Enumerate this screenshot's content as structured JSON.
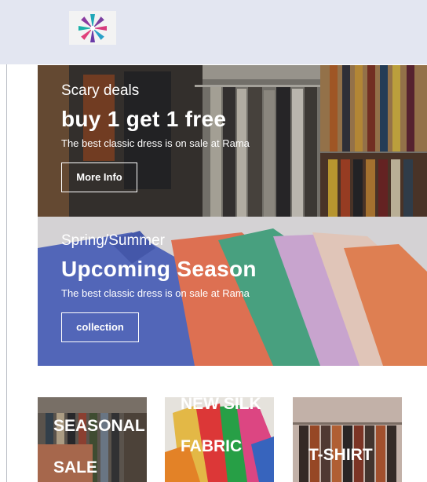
{
  "header": {
    "logo_icon": "flower-logo-icon"
  },
  "banners": [
    {
      "subtitle": "Scary deals",
      "headline": "buy 1 get 1 free",
      "description": "The best classic dress is on sale at Rama",
      "button_label": "More Info"
    },
    {
      "subtitle": "Spring/Summer",
      "headline": "Upcoming Season",
      "description": "The best classic dress is on sale at Rama",
      "button_label": "collection"
    }
  ],
  "categories": [
    {
      "line1": "SEASONAL",
      "line2": "SALE"
    },
    {
      "line1": "NEW SILK",
      "line2": "FABRIC"
    },
    {
      "line1": "T-SHIRT"
    }
  ],
  "colors": {
    "header_bg": "#e3e6f1",
    "banner_text": "#ffffff",
    "page_bg": "#ffffff"
  }
}
